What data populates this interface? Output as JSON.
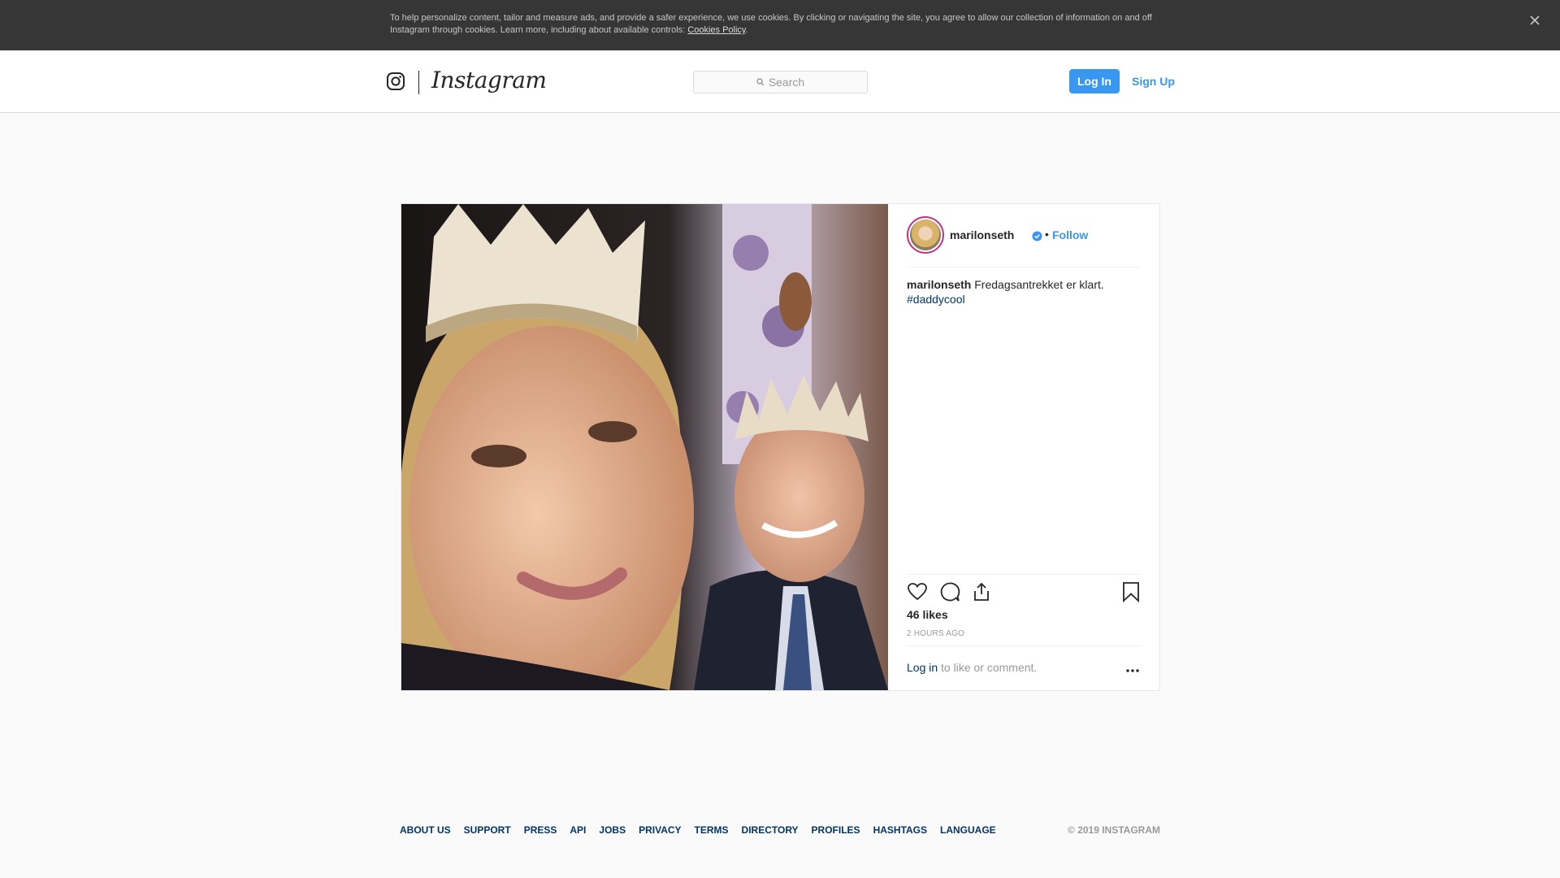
{
  "cookie_banner": {
    "text": "To help personalize content, tailor and measure ads, and provide a safer experience, we use cookies. By clicking or navigating the site, you agree to allow our collection of information on and off Instagram through cookies. Learn more, including about available controls: ",
    "link_label": "Cookies Policy",
    "suffix": ".",
    "close_icon": "close-icon"
  },
  "header": {
    "wordmark": "Instagram",
    "search_placeholder": "Search",
    "login_label": "Log In",
    "signup_label": "Sign Up"
  },
  "post": {
    "username": "marilonseth",
    "verified": true,
    "separator": "•",
    "follow_label": "Follow",
    "caption": {
      "username": "marilonseth",
      "text": " Fredagsantrekket er klart.",
      "hashtag": "#daddycool"
    },
    "likes": "46 likes",
    "time_ago": "2 HOURS AGO",
    "comment_prompt": {
      "login_label": "Log in",
      "text": " to like or comment."
    },
    "icons": [
      "heart-icon",
      "comment-icon",
      "share-icon",
      "bookmark-icon",
      "more-options-icon"
    ]
  },
  "footer": {
    "links": [
      "About us",
      "Support",
      "Press",
      "API",
      "Jobs",
      "Privacy",
      "Terms",
      "Directory",
      "Profiles",
      "Hashtags",
      "Language"
    ],
    "copyright": "© 2019 INSTAGRAM"
  },
  "colors": {
    "accent": "#3897f0",
    "link_dark": "#003569",
    "banner_bg": "#363636"
  }
}
